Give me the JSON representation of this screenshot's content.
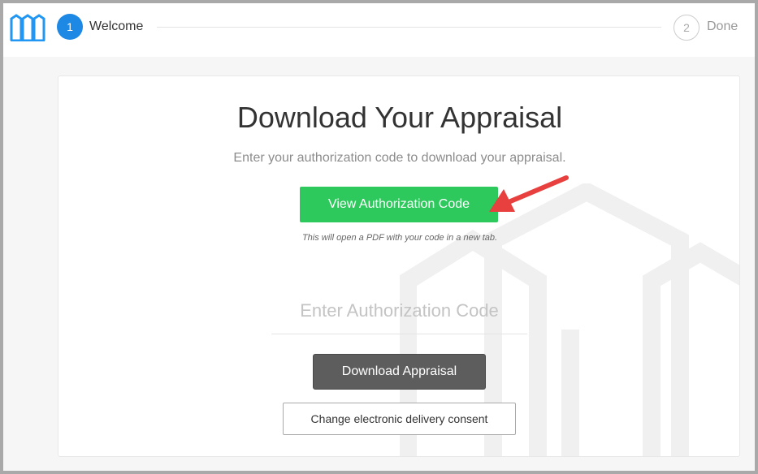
{
  "stepper": {
    "steps": [
      {
        "number": "1",
        "label": "Welcome",
        "active": true
      },
      {
        "number": "2",
        "label": "Done",
        "active": false
      }
    ]
  },
  "main": {
    "title": "Download Your Appraisal",
    "subtitle": "Enter your authorization code to download your appraisal.",
    "view_code_label": "View Authorization Code",
    "view_code_note": "This will open a PDF with your code in a new tab.",
    "code_input": {
      "value": "",
      "placeholder": "Enter Authorization Code"
    },
    "download_label": "Download Appraisal",
    "consent_label": "Change electronic delivery consent"
  },
  "icons": {
    "logo": "building-logo-icon",
    "annotation": "red-arrow-icon",
    "watermark": "building-watermark-icon"
  },
  "colors": {
    "step_active": "#1e88e5",
    "primary_button": "#2ec95c",
    "download_button": "#5d5d5d",
    "annotation_arrow": "#e8403e"
  }
}
